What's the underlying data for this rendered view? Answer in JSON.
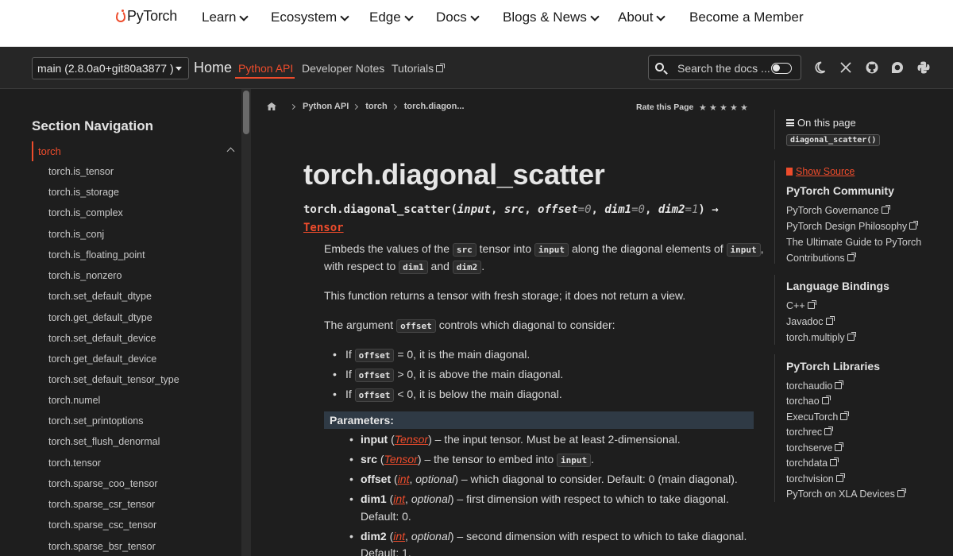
{
  "site_nav": {
    "logo_text": "PyTorch",
    "items": [
      "Learn",
      "Ecosystem",
      "Edge",
      "Docs",
      "Blogs & News",
      "About"
    ],
    "member": "Become a Member"
  },
  "doc_header": {
    "version": "main (2.8.0a0+git80a3877 )",
    "home": "Home",
    "tabs": [
      "Python API",
      "Developer Notes",
      "Tutorials"
    ],
    "search_placeholder": "Search the docs ...",
    "icons": [
      "moon-icon",
      "x-icon",
      "github-icon",
      "forum-icon",
      "python-icon"
    ]
  },
  "left_nav": {
    "title": "Section Navigation",
    "active": "torch",
    "items": [
      "torch.is_tensor",
      "torch.is_storage",
      "torch.is_complex",
      "torch.is_conj",
      "torch.is_floating_point",
      "torch.is_nonzero",
      "torch.set_default_dtype",
      "torch.get_default_dtype",
      "torch.set_default_device",
      "torch.get_default_device",
      "torch.set_default_tensor_type",
      "torch.numel",
      "torch.set_printoptions",
      "torch.set_flush_denormal",
      "torch.tensor",
      "torch.sparse_coo_tensor",
      "torch.sparse_csr_tensor",
      "torch.sparse_csc_tensor",
      "torch.sparse_bsr_tensor"
    ]
  },
  "breadcrumb": {
    "items": [
      "Python API",
      "torch",
      "torch.diagon..."
    ],
    "rate_label": "Rate this Page",
    "stars": "★"
  },
  "content": {
    "title": "torch.diagonal_scatter",
    "sig": {
      "mod": "torch.",
      "fn": "diagonal_scatter",
      "open": "(",
      "p1": "input",
      "sep1": ", ",
      "p2": "src",
      "sep2": ", ",
      "p3": "offset",
      "eq": "=",
      "v3": "0",
      "p4": "dim1",
      "v4": "0",
      "p5": "dim2",
      "v5": "1",
      "close": ")",
      "arrow": "→",
      "ret": "Tensor"
    },
    "desc": {
      "a": "Embeds the values of the",
      "src": "src",
      "b": "tensor into",
      "input": "input",
      "c": "along the diagonal elements of",
      "d": ",",
      "e": "with respect to",
      "dim1": "dim1",
      "and": "and",
      "dim2": "dim2",
      "end": "."
    },
    "para2": "This function returns a tensor with fresh storage; it does not return a view.",
    "para3_a": "The argument",
    "para3_code": "offset",
    "para3_b": "controls which diagonal to consider:",
    "bullets": [
      {
        "pre": "If",
        "code": "offset",
        "post": "= 0, it is the main diagonal."
      },
      {
        "pre": "If",
        "code": "offset",
        "post": "> 0, it is above the main diagonal."
      },
      {
        "pre": "If",
        "code": "offset",
        "post": "< 0, it is below the main diagonal."
      }
    ],
    "params_header": "Parameters:",
    "params": {
      "input": {
        "name": "input",
        "open": " (",
        "type": "Tensor",
        "close": ")",
        "desc": " – the input tensor. Must be at least 2-dimensional."
      },
      "src": {
        "name": "src",
        "open": " (",
        "type": "Tensor",
        "close": ")",
        "desc": " – the tensor to embed into",
        "code": "input",
        "end": "."
      },
      "offset": {
        "name": "offset",
        "open": " (",
        "type": "int",
        "comma": ", ",
        "opt": "optional",
        "close": ")",
        "desc": " – which diagonal to consider. Default: 0 (main diagonal)."
      },
      "dim1": {
        "name": "dim1",
        "open": " (",
        "type": "int",
        "comma": ", ",
        "opt": "optional",
        "close": ")",
        "desc": " – first dimension with respect to which to take diagonal.",
        "cont": "Default: 0."
      },
      "dim2": {
        "name": "dim2",
        "open": " (",
        "type": "int",
        "comma": ", ",
        "opt": "optional",
        "close": ")",
        "desc": " – second dimension with respect to which to take diagonal.",
        "cont": "Default: 1."
      }
    }
  },
  "right_sidebar": {
    "on_this_page": "On this page",
    "anchor": "diagonal_scatter()",
    "show_source": "Show Source",
    "community_title": "PyTorch Community",
    "community": [
      "PyTorch Governance",
      "PyTorch Design Philosophy",
      "The Ultimate Guide to PyTorch",
      "Contributions"
    ],
    "bindings_title": "Language Bindings",
    "bindings": [
      "C++",
      "Javadoc",
      "torch.multiply"
    ],
    "libraries_title": "PyTorch Libraries",
    "libraries": [
      "torchaudio",
      "torchao",
      "ExecuTorch",
      "torchrec",
      "torchserve",
      "torchdata",
      "torchvision",
      "PyTorch on XLA Devices"
    ]
  },
  "colors": {
    "accent": "#ee4c2c",
    "background": "#1e1e1e",
    "header": "#262626",
    "nav": "#ffffff"
  }
}
